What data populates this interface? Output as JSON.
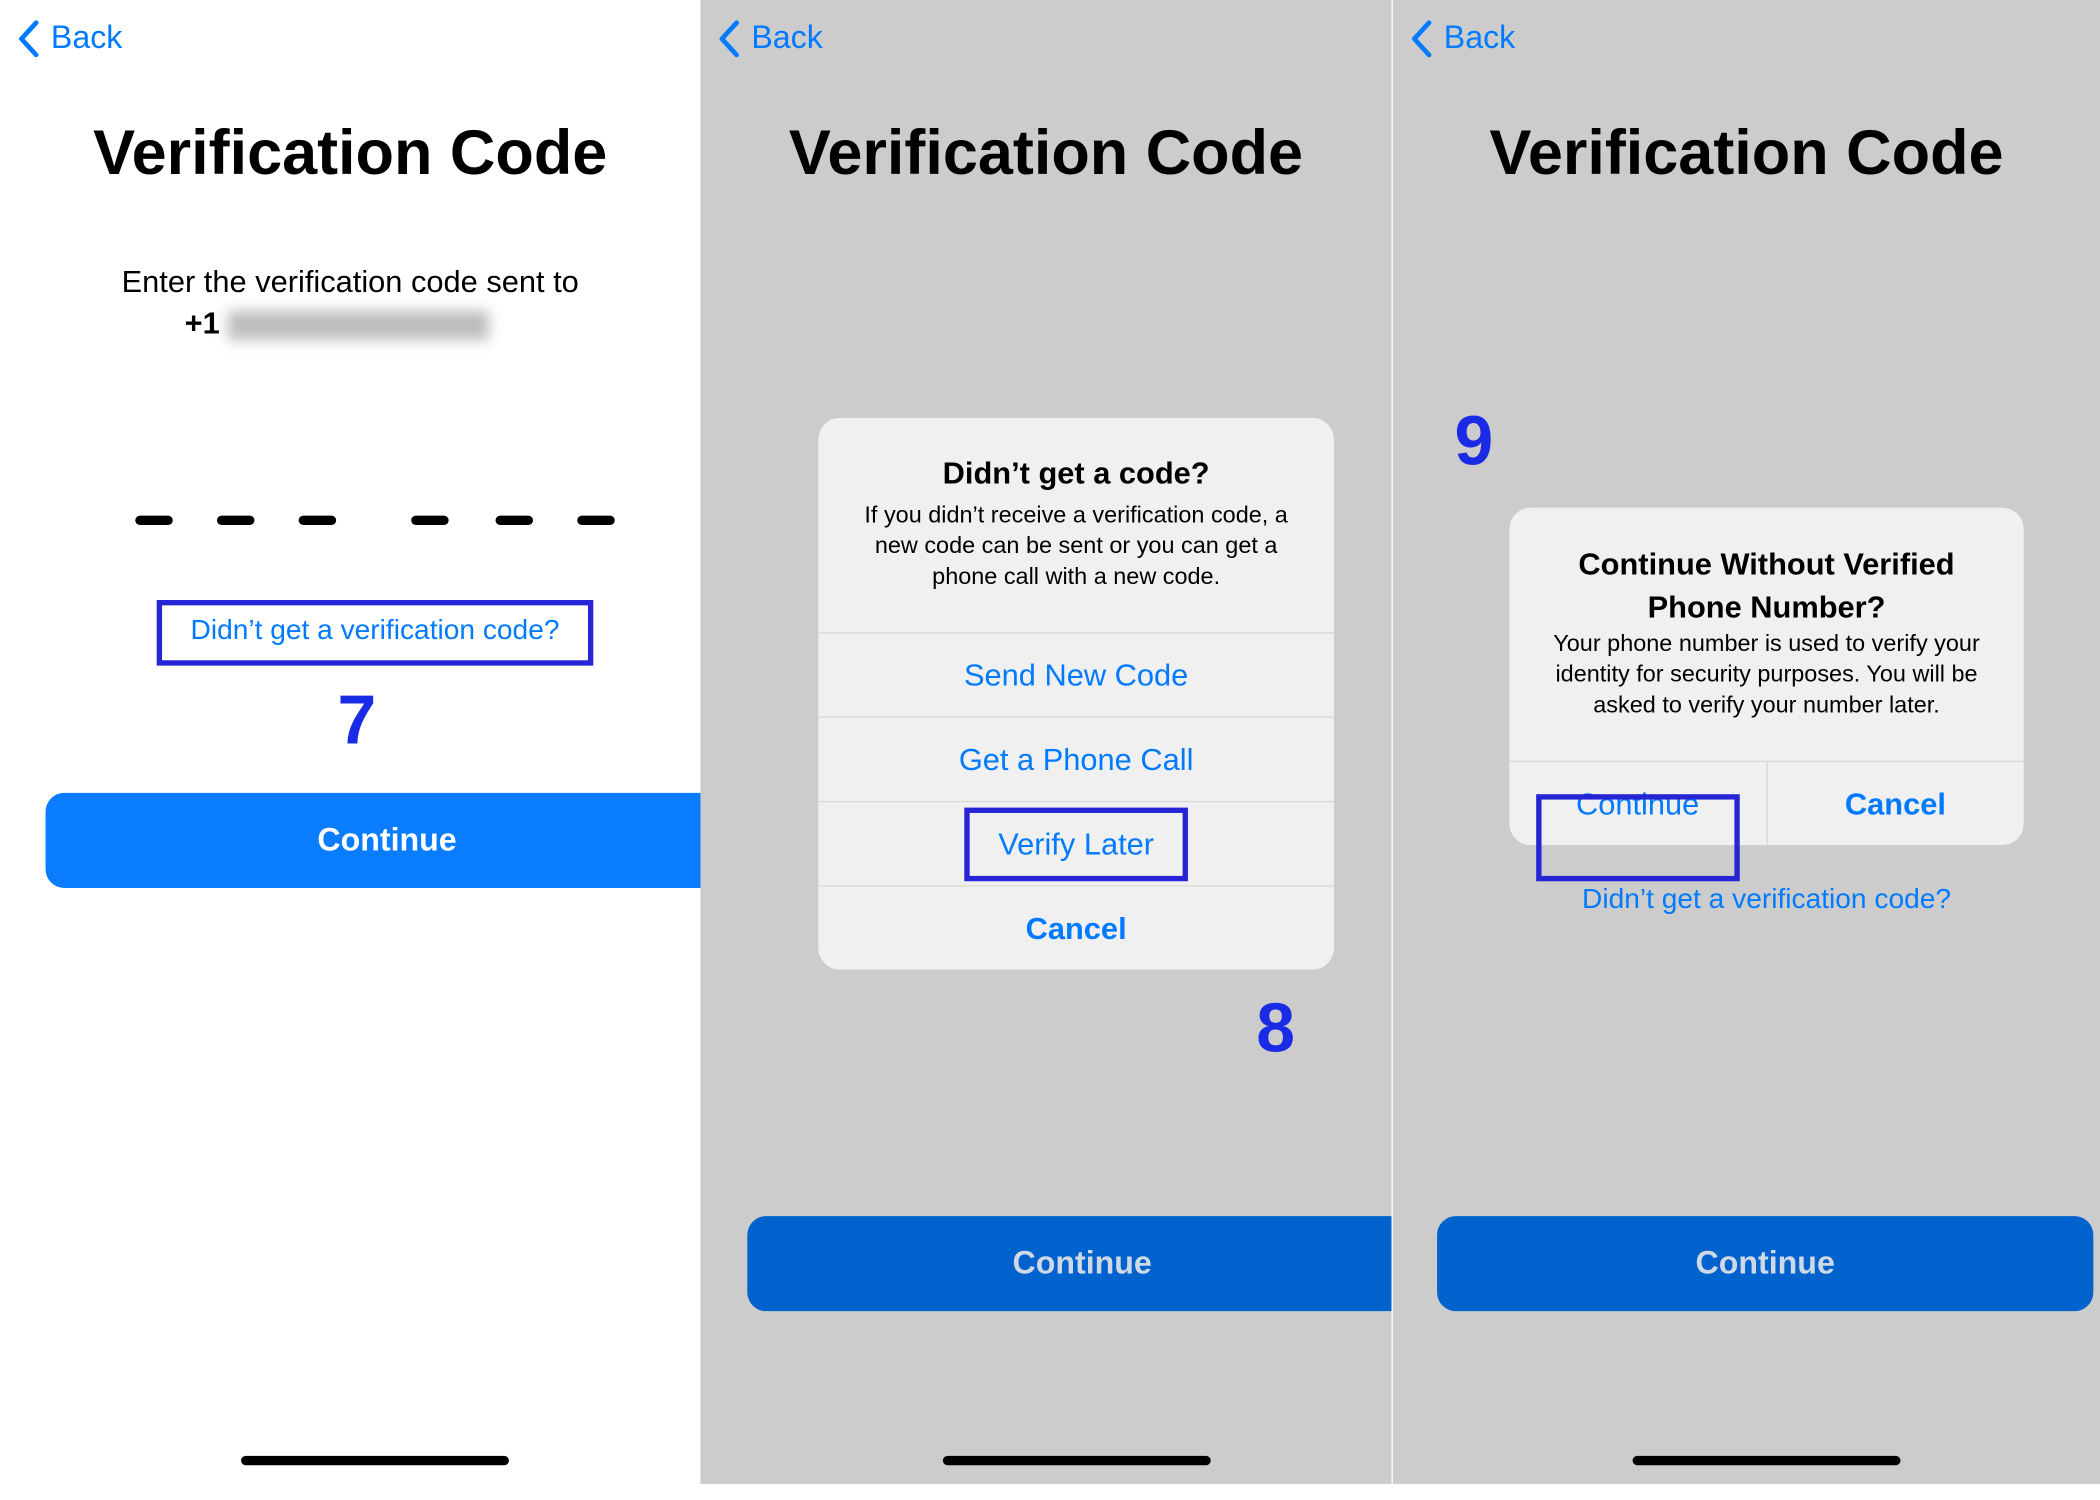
{
  "colors": {
    "accent": "#007aff",
    "highlight": "#2525d6",
    "step_number": "#1a2be6",
    "dimmed_button": "#0062cc",
    "overlay_gray": "#cccccc"
  },
  "common": {
    "back_label": "Back",
    "title": "Verification Code",
    "continue_label": "Continue",
    "back_icon": "chevron-left-icon"
  },
  "screen1": {
    "instruction": "Enter the verification code sent to",
    "phone_prefix": "+1",
    "phone_number_blurred": "(•••) •••-••••",
    "code_slots": 6,
    "resend_link": "Didn’t get a verification code?",
    "step": "7"
  },
  "screen2": {
    "alert": {
      "title": "Didn’t get a code?",
      "message": "If you didn’t receive a verification code, a new code can be sent or you can get a phone call with a new code.",
      "buttons": [
        "Send New Code",
        "Get a Phone Call",
        "Verify Later",
        "Cancel"
      ]
    },
    "step": "8"
  },
  "screen3": {
    "alert": {
      "title": "Continue Without Verified Phone Number?",
      "message": "Your phone number is used to verify your identity for security purposes. You will be asked to verify your number later.",
      "continue": "Continue",
      "cancel": "Cancel"
    },
    "resend_link": "Didn’t get a verification code?",
    "step": "9"
  }
}
